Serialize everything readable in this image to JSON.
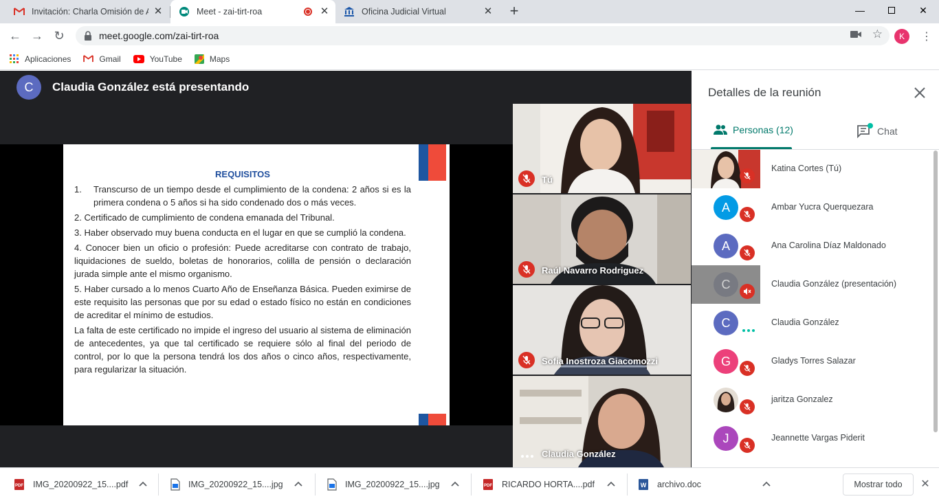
{
  "browser": {
    "tabs": [
      {
        "title": "Invitación: Charla Omisión de Ant",
        "icon": "gmail-icon"
      },
      {
        "title": "Meet - zai-tirt-roa",
        "icon": "meet-icon",
        "recording": true
      },
      {
        "title": "Oficina Judicial Virtual",
        "icon": "bank-icon"
      }
    ],
    "new_tab": "+",
    "url": "meet.google.com/zai-tirt-roa",
    "profile_initial": "K",
    "bookmarks": [
      {
        "label": "Aplicaciones",
        "icon": "apps-grid-icon"
      },
      {
        "label": "Gmail",
        "icon": "gmail-icon"
      },
      {
        "label": "YouTube",
        "icon": "youtube-icon"
      },
      {
        "label": "Maps",
        "icon": "maps-icon"
      }
    ]
  },
  "meet": {
    "presenter_initial": "C",
    "presenter_text": "Claudia González está presentando",
    "slide": {
      "title": "REQUISITOS",
      "items": [
        {
          "num": "1.",
          "text": "Transcurso de un tiempo desde el cumplimiento de la condena:  2 años si es la primera condena o 5 años si ha sido condenado dos o más veces."
        },
        {
          "text": "2. Certificado de cumplimiento de condena emanada del Tribunal."
        },
        {
          "text": "3. Haber observado muy buena conducta en el lugar en que se cumplió la condena."
        },
        {
          "text": "4. Conocer bien un oficio o profesión: Puede acreditarse con contrato de trabajo, liquidaciones de sueldo, boletas de honorarios, colilla de pensión o declaración jurada simple ante el mismo organismo."
        },
        {
          "text": "5. Haber cursado a lo menos Cuarto Año de Enseñanza Básica. Pueden eximirse de este requisito las personas que por su edad o estado físico no están en condiciones de acreditar el mínimo de estudios."
        },
        {
          "text": "La falta de este certificado no impide el ingreso del usuario al sistema de eliminación de antecedentes, ya que tal certificado se requiere sólo al final del periodo de control, por lo que la persona tendrá los dos años o cinco años, respectivamente, para regularizar la situación."
        }
      ]
    },
    "tiles": [
      {
        "name": "Tú",
        "muted": true
      },
      {
        "name": "Raúl Navarro Rodriguez",
        "muted": true
      },
      {
        "name": "Sofia Inostroza Giacomozzi",
        "muted": true
      },
      {
        "name": "Claudia González",
        "muted": false
      }
    ]
  },
  "panel": {
    "title": "Detalles de la reunión",
    "tab_people": "Personas (12)",
    "tab_chat": "Chat",
    "people": [
      {
        "name": "Katina Cortes (Tú)",
        "avatar": "video",
        "status": "muted"
      },
      {
        "name": "Ambar Yucra Querquezara",
        "initial": "A",
        "color": "#039be5",
        "status": "muted"
      },
      {
        "name": "Ana Carolina Díaz Maldonado",
        "initial": "A",
        "color": "#5c6bc0",
        "status": "muted"
      },
      {
        "name": "Claudia González (presentación)",
        "initial": "C",
        "color": "#5c6bc0",
        "status": "speaker-off",
        "presentation": true
      },
      {
        "name": "Claudia González",
        "initial": "C",
        "color": "#5c6bc0",
        "status": "speaking"
      },
      {
        "name": "Gladys Torres Salazar",
        "initial": "G",
        "color": "#ec407a",
        "status": "muted"
      },
      {
        "name": "jaritza Gonzalez",
        "avatar": "photo",
        "status": "muted"
      },
      {
        "name": "Jeannette Vargas Piderit",
        "initial": "J",
        "color": "#ab47bc",
        "status": "muted"
      }
    ]
  },
  "downloads": {
    "items": [
      {
        "name": "IMG_20200922_15....pdf",
        "icon": "pdf-icon"
      },
      {
        "name": "IMG_20200922_15....jpg",
        "icon": "file-icon"
      },
      {
        "name": "IMG_20200922_15....jpg",
        "icon": "file-icon"
      },
      {
        "name": "RICARDO HORTA....pdf",
        "icon": "pdf-icon"
      },
      {
        "name": "archivo.doc",
        "icon": "word-icon"
      }
    ],
    "show_all": "Mostrar todo"
  }
}
